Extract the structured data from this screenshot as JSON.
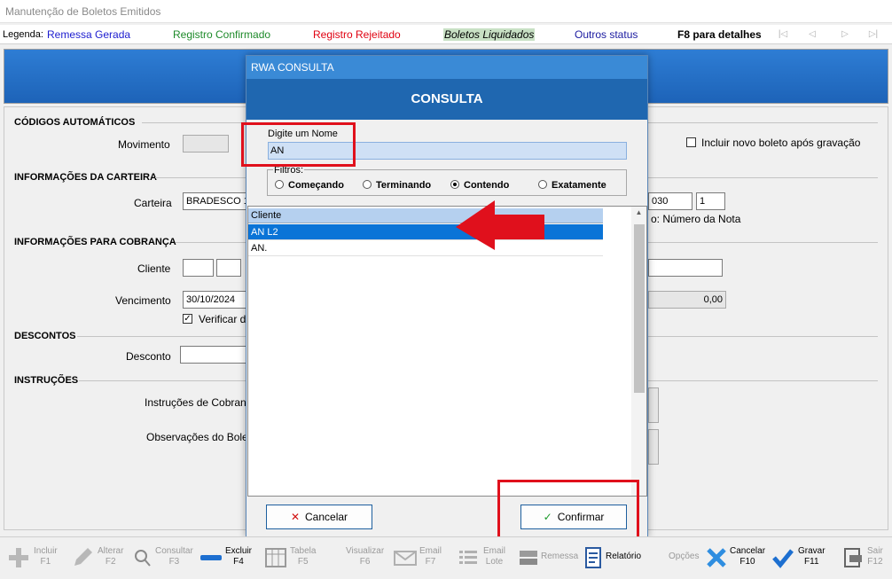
{
  "window": {
    "title": "Manutenção de Boletos Emitidos"
  },
  "legend": {
    "label": "Legenda:",
    "remessa": "Remessa Gerada",
    "confirmado": "Registro Confirmado",
    "rejeitado": "Registro Rejeitado",
    "liquidados": "Boletos Liquidados",
    "outros": "Outros status",
    "f8": "F8 para detalhes"
  },
  "form": {
    "codigos_title": "CÓDIGOS AUTOMÁTICOS",
    "movimento_label": "Movimento",
    "incluir_novo": "Incluir novo boleto após gravação",
    "carteira_title": "INFORMAÇÕES DA CARTEIRA",
    "carteira_label": "Carteira",
    "carteira_value": "BRADESCO  1",
    "carteira_code": "030",
    "carteira_num": "1",
    "nota_text": "o: Número da Nota",
    "cobranca_title": "INFORMAÇÕES PARA COBRANÇA",
    "cliente_label": "Cliente",
    "vencimento_label": "Vencimento",
    "vencimento_value": "30/10/2024",
    "valor_value": "0,00",
    "verificar_label": "Verificar di",
    "descontos_title": "DESCONTOS",
    "desconto_label": "Desconto",
    "instrucoes_title": "INSTRUÇÕES",
    "instrucoes_label": "Instruções de Cobranç",
    "observacoes_label": "Observações do Boleto"
  },
  "modal": {
    "title": "RWA CONSULTA",
    "header": "CONSULTA",
    "name_label": "Digite um Nome",
    "name_value": "AN",
    "filters_label": "Filtros:",
    "filters": [
      "Começando",
      "Terminando",
      "Contendo",
      "Exatamente"
    ],
    "selected_filter": "Contendo",
    "column_header": "Cliente",
    "rows": [
      "AN L2",
      "AN."
    ],
    "cancel_label": "Cancelar",
    "confirm_label": "Confirmar"
  },
  "toolbar": {
    "incluir": [
      "Incluir",
      "F1"
    ],
    "alterar": [
      "Alterar",
      "F2"
    ],
    "consultar": [
      "Consultar",
      "F3"
    ],
    "excluir": [
      "Excluir",
      "F4"
    ],
    "tabela": [
      "Tabela",
      "F5"
    ],
    "visualizar": [
      "Visualizar",
      "F6"
    ],
    "email": [
      "Email",
      "F7"
    ],
    "email_lote": [
      "Email",
      "Lote"
    ],
    "remessa": "Remessa",
    "relatorio": "Relatório",
    "opcoes": "Opções",
    "cancelar": [
      "Cancelar",
      "F10"
    ],
    "gravar": [
      "Gravar",
      "F11"
    ],
    "sair": [
      "Sair",
      "F12"
    ]
  },
  "colors": {
    "accent": "#1f67b0",
    "selection": "#0a74d7",
    "highlight": "#e0101c"
  }
}
